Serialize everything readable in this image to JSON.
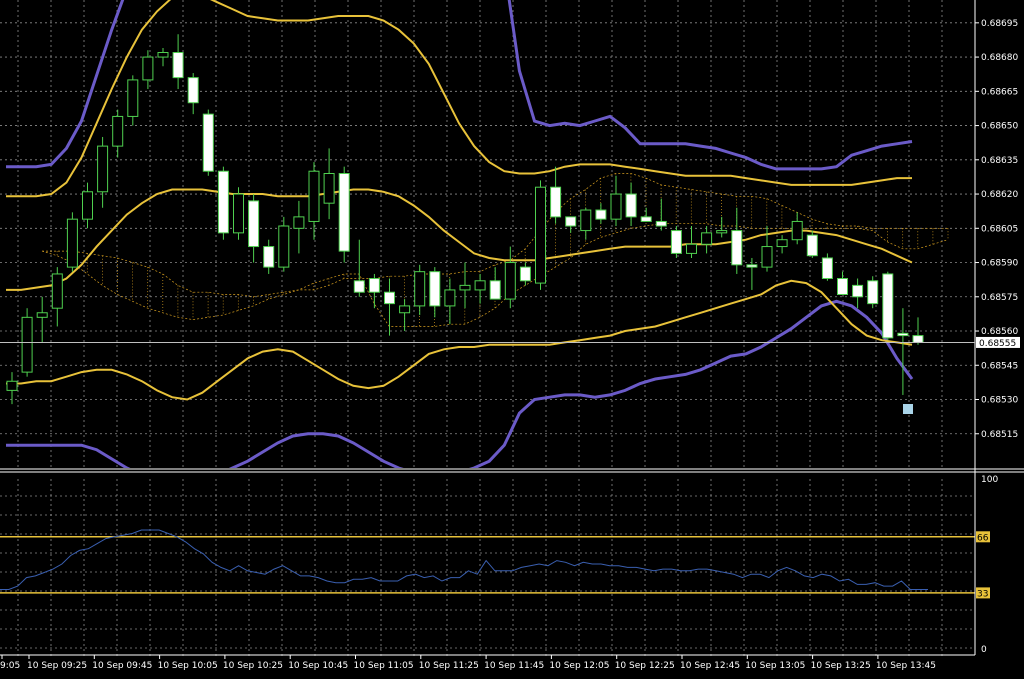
{
  "chart_data": {
    "type": "candlestick",
    "colors": {
      "background": "#000000",
      "grid": "#8c8c8c",
      "candle_up": "#ffffff",
      "candle_down": "#ffffff",
      "wick": "#4fd04f",
      "bb_outer": "#6b5bc8",
      "bb_inner": "#e8c23a",
      "cloud": "#d8a020",
      "oscillator": "#3a5fb0",
      "level": "#e8c23a",
      "axis_text": "#ffffff"
    },
    "price_axis": {
      "ylim": [
        0.685,
        0.68705
      ],
      "ticks": [
        "0.68695",
        "0.68680",
        "0.68665",
        "0.68650",
        "0.68635",
        "0.68620",
        "0.68605",
        "0.68590",
        "0.68575",
        "0.68560",
        "0.68545",
        "0.68530",
        "0.68515"
      ]
    },
    "current_price": "0.68555",
    "x_labels": [
      "9:05",
      "10 Sep 09:25",
      "10 Sep 09:45",
      "10 Sep 10:05",
      "10 Sep 10:25",
      "10 Sep 10:45",
      "10 Sep 11:05",
      "10 Sep 11:25",
      "10 Sep 11:45",
      "10 Sep 12:05",
      "10 Sep 12:25",
      "10 Sep 12:45",
      "10 Sep 13:05",
      "10 Sep 13:25",
      "10 Sep 13:45"
    ],
    "candles": [
      {
        "o": 0.68534,
        "h": 0.68542,
        "l": 0.68528,
        "c": 0.68538
      },
      {
        "o": 0.68542,
        "h": 0.6857,
        "l": 0.6854,
        "c": 0.68566
      },
      {
        "o": 0.68566,
        "h": 0.68575,
        "l": 0.68555,
        "c": 0.68568
      },
      {
        "o": 0.6857,
        "h": 0.68588,
        "l": 0.68562,
        "c": 0.68585
      },
      {
        "o": 0.68588,
        "h": 0.68612,
        "l": 0.68586,
        "c": 0.68609
      },
      {
        "o": 0.68609,
        "h": 0.68625,
        "l": 0.68605,
        "c": 0.68621
      },
      {
        "o": 0.68621,
        "h": 0.68645,
        "l": 0.68614,
        "c": 0.68641
      },
      {
        "o": 0.68641,
        "h": 0.68657,
        "l": 0.68636,
        "c": 0.68654
      },
      {
        "o": 0.68654,
        "h": 0.68672,
        "l": 0.6865,
        "c": 0.6867
      },
      {
        "o": 0.6867,
        "h": 0.68683,
        "l": 0.68666,
        "c": 0.6868
      },
      {
        "o": 0.6868,
        "h": 0.68684,
        "l": 0.68676,
        "c": 0.68682
      },
      {
        "o": 0.68682,
        "h": 0.6869,
        "l": 0.68666,
        "c": 0.68671
      },
      {
        "o": 0.68671,
        "h": 0.68673,
        "l": 0.68655,
        "c": 0.6866
      },
      {
        "o": 0.68655,
        "h": 0.68657,
        "l": 0.68628,
        "c": 0.6863
      },
      {
        "o": 0.6863,
        "h": 0.68632,
        "l": 0.686,
        "c": 0.68603
      },
      {
        "o": 0.68603,
        "h": 0.68623,
        "l": 0.686,
        "c": 0.6862
      },
      {
        "o": 0.68617,
        "h": 0.6862,
        "l": 0.6859,
        "c": 0.68597
      },
      {
        "o": 0.68597,
        "h": 0.686,
        "l": 0.68585,
        "c": 0.68588
      },
      {
        "o": 0.68588,
        "h": 0.6861,
        "l": 0.68586,
        "c": 0.68606
      },
      {
        "o": 0.68605,
        "h": 0.68617,
        "l": 0.68594,
        "c": 0.6861
      },
      {
        "o": 0.68608,
        "h": 0.68634,
        "l": 0.686,
        "c": 0.6863
      },
      {
        "o": 0.68616,
        "h": 0.6864,
        "l": 0.68609,
        "c": 0.68629
      },
      {
        "o": 0.68629,
        "h": 0.68632,
        "l": 0.6859,
        "c": 0.68595
      },
      {
        "o": 0.68582,
        "h": 0.686,
        "l": 0.68575,
        "c": 0.68577
      },
      {
        "o": 0.68583,
        "h": 0.68585,
        "l": 0.6857,
        "c": 0.68577
      },
      {
        "o": 0.68577,
        "h": 0.68583,
        "l": 0.68558,
        "c": 0.68572
      },
      {
        "o": 0.68568,
        "h": 0.68574,
        "l": 0.6856,
        "c": 0.68571
      },
      {
        "o": 0.68571,
        "h": 0.68589,
        "l": 0.68567,
        "c": 0.68586
      },
      {
        "o": 0.68586,
        "h": 0.68588,
        "l": 0.68566,
        "c": 0.68571
      },
      {
        "o": 0.68571,
        "h": 0.68583,
        "l": 0.68563,
        "c": 0.68578
      },
      {
        "o": 0.68578,
        "h": 0.6859,
        "l": 0.6857,
        "c": 0.6858
      },
      {
        "o": 0.68578,
        "h": 0.68585,
        "l": 0.68572,
        "c": 0.68582
      },
      {
        "o": 0.68582,
        "h": 0.68588,
        "l": 0.68574,
        "c": 0.68574
      },
      {
        "o": 0.68574,
        "h": 0.68597,
        "l": 0.6857,
        "c": 0.6859
      },
      {
        "o": 0.68588,
        "h": 0.6859,
        "l": 0.6858,
        "c": 0.68582
      },
      {
        "o": 0.68581,
        "h": 0.68626,
        "l": 0.68578,
        "c": 0.68623
      },
      {
        "o": 0.68623,
        "h": 0.68632,
        "l": 0.68607,
        "c": 0.6861
      },
      {
        "o": 0.6861,
        "h": 0.68606,
        "l": 0.68603,
        "c": 0.68606
      },
      {
        "o": 0.68604,
        "h": 0.68614,
        "l": 0.686,
        "c": 0.68613
      },
      {
        "o": 0.68613,
        "h": 0.68616,
        "l": 0.68607,
        "c": 0.68609
      },
      {
        "o": 0.68609,
        "h": 0.68628,
        "l": 0.68606,
        "c": 0.6862
      },
      {
        "o": 0.6862,
        "h": 0.68625,
        "l": 0.68606,
        "c": 0.6861
      },
      {
        "o": 0.6861,
        "h": 0.68614,
        "l": 0.68608,
        "c": 0.68608
      },
      {
        "o": 0.68608,
        "h": 0.68618,
        "l": 0.68604,
        "c": 0.68606
      },
      {
        "o": 0.68604,
        "h": 0.68606,
        "l": 0.68592,
        "c": 0.68594
      },
      {
        "o": 0.68594,
        "h": 0.68606,
        "l": 0.68592,
        "c": 0.68598
      },
      {
        "o": 0.68598,
        "h": 0.68606,
        "l": 0.68594,
        "c": 0.68603
      },
      {
        "o": 0.68603,
        "h": 0.6861,
        "l": 0.68601,
        "c": 0.68604
      },
      {
        "o": 0.68604,
        "h": 0.68614,
        "l": 0.68585,
        "c": 0.68589
      },
      {
        "o": 0.68589,
        "h": 0.68592,
        "l": 0.68578,
        "c": 0.68588
      },
      {
        "o": 0.68588,
        "h": 0.68606,
        "l": 0.68586,
        "c": 0.68597
      },
      {
        "o": 0.68597,
        "h": 0.68602,
        "l": 0.68594,
        "c": 0.686
      },
      {
        "o": 0.686,
        "h": 0.68612,
        "l": 0.68598,
        "c": 0.68608
      },
      {
        "o": 0.68602,
        "h": 0.68604,
        "l": 0.68592,
        "c": 0.68593
      },
      {
        "o": 0.68592,
        "h": 0.68594,
        "l": 0.68582,
        "c": 0.68583
      },
      {
        "o": 0.68583,
        "h": 0.68586,
        "l": 0.68576,
        "c": 0.68576
      },
      {
        "o": 0.6858,
        "h": 0.68583,
        "l": 0.6857,
        "c": 0.68575
      },
      {
        "o": 0.68582,
        "h": 0.68584,
        "l": 0.6857,
        "c": 0.68572
      },
      {
        "o": 0.68585,
        "h": 0.68586,
        "l": 0.68556,
        "c": 0.68557
      },
      {
        "o": 0.68559,
        "h": 0.6857,
        "l": 0.68532,
        "c": 0.68558
      },
      {
        "o": 0.68558,
        "h": 0.68566,
        "l": 0.68554,
        "c": 0.68555
      }
    ],
    "bb_outer_upper": [
      0.68632,
      0.68632,
      0.68632,
      0.68633,
      0.6864,
      0.68652,
      0.68672,
      0.68692,
      0.6871,
      0.68725,
      0.68735,
      0.6874,
      0.68742,
      0.68742,
      0.68742,
      0.68742,
      0.68742,
      0.68742,
      0.68742,
      0.68742,
      0.68742,
      0.68742,
      0.68742,
      0.68742,
      0.68742,
      0.68742,
      0.68742,
      0.68742,
      0.68742,
      0.68742,
      0.68742,
      0.68742,
      0.68742,
      0.6872,
      0.68674,
      0.68652,
      0.6865,
      0.68651,
      0.6865,
      0.68652,
      0.68654,
      0.68649,
      0.68642,
      0.68642,
      0.68642,
      0.68642,
      0.68641,
      0.6864,
      0.68638,
      0.68636,
      0.68633,
      0.68631,
      0.68631,
      0.68631,
      0.68631,
      0.68632,
      0.68637,
      0.68639,
      0.68641,
      0.68642,
      0.68643
    ],
    "bb_inner_upper": [
      0.68619,
      0.68619,
      0.68619,
      0.6862,
      0.68625,
      0.68636,
      0.68651,
      0.68666,
      0.6868,
      0.68692,
      0.687,
      0.68706,
      0.68708,
      0.68707,
      0.68704,
      0.68701,
      0.68698,
      0.68697,
      0.68696,
      0.68696,
      0.68696,
      0.68697,
      0.68698,
      0.68698,
      0.68698,
      0.68696,
      0.68692,
      0.68686,
      0.68677,
      0.68664,
      0.68651,
      0.68641,
      0.68634,
      0.6863,
      0.68629,
      0.68629,
      0.6863,
      0.68632,
      0.68633,
      0.68633,
      0.68633,
      0.68632,
      0.68631,
      0.6863,
      0.68629,
      0.68628,
      0.68628,
      0.68628,
      0.68628,
      0.68627,
      0.68626,
      0.68625,
      0.68624,
      0.68624,
      0.68624,
      0.68624,
      0.68624,
      0.68625,
      0.68626,
      0.68627,
      0.68627
    ],
    "bb_middle": [
      0.68578,
      0.68578,
      0.68579,
      0.6858,
      0.68583,
      0.68589,
      0.68597,
      0.68604,
      0.68611,
      0.68616,
      0.6862,
      0.68622,
      0.68622,
      0.68622,
      0.68621,
      0.6862,
      0.6862,
      0.6862,
      0.68619,
      0.68619,
      0.68619,
      0.6862,
      0.68621,
      0.68622,
      0.68622,
      0.68621,
      0.68619,
      0.68615,
      0.6861,
      0.68604,
      0.68599,
      0.68594,
      0.68592,
      0.68591,
      0.68591,
      0.68591,
      0.68592,
      0.68593,
      0.68594,
      0.68595,
      0.68596,
      0.68597,
      0.68597,
      0.68597,
      0.68597,
      0.68598,
      0.68598,
      0.68598,
      0.68599,
      0.686,
      0.68602,
      0.68603,
      0.68604,
      0.68604,
      0.68603,
      0.68602,
      0.686,
      0.68598,
      0.68596,
      0.68593,
      0.6859
    ],
    "bb_inner_lower": [
      0.68537,
      0.68537,
      0.68538,
      0.68538,
      0.6854,
      0.68542,
      0.68543,
      0.68543,
      0.68541,
      0.68538,
      0.68534,
      0.68531,
      0.6853,
      0.68533,
      0.68538,
      0.68543,
      0.68548,
      0.68551,
      0.68552,
      0.68551,
      0.68547,
      0.68543,
      0.68539,
      0.68536,
      0.68535,
      0.68536,
      0.6854,
      0.68545,
      0.6855,
      0.68552,
      0.68553,
      0.68553,
      0.68554,
      0.68554,
      0.68554,
      0.68554,
      0.68554,
      0.68555,
      0.68556,
      0.68557,
      0.68558,
      0.6856,
      0.68561,
      0.68562,
      0.68564,
      0.68566,
      0.68568,
      0.6857,
      0.68572,
      0.68574,
      0.68576,
      0.6858,
      0.68582,
      0.68581,
      0.68577,
      0.6857,
      0.68563,
      0.68558,
      0.68556,
      0.68555,
      0.68554
    ],
    "bb_outer_lower": [
      0.6851,
      0.6851,
      0.6851,
      0.6851,
      0.6851,
      0.6851,
      0.68508,
      0.68504,
      0.685,
      0.68497,
      0.68495,
      0.68494,
      0.68494,
      0.68495,
      0.68497,
      0.685,
      0.68503,
      0.68507,
      0.68511,
      0.68514,
      0.68515,
      0.68515,
      0.68514,
      0.68511,
      0.68507,
      0.68503,
      0.685,
      0.68498,
      0.68497,
      0.68497,
      0.68498,
      0.685,
      0.68503,
      0.6851,
      0.68524,
      0.6853,
      0.68531,
      0.68532,
      0.68532,
      0.68531,
      0.68532,
      0.68534,
      0.68537,
      0.68539,
      0.6854,
      0.68541,
      0.68543,
      0.68546,
      0.68549,
      0.6855,
      0.68553,
      0.68557,
      0.68561,
      0.68566,
      0.68571,
      0.68573,
      0.68571,
      0.68566,
      0.68559,
      0.68548,
      0.68539
    ],
    "cloud_a": [
      0.68595,
      0.68595,
      0.68595,
      0.68594,
      0.68593,
      0.68592,
      0.6859,
      0.68588,
      0.68585,
      0.6858,
      0.68577,
      0.68577,
      0.68576,
      0.68576,
      0.68575,
      0.68576,
      0.68577,
      0.68578,
      0.68578,
      0.6858,
      0.68583,
      0.68583,
      0.68583,
      0.68584,
      0.68584,
      0.68585,
      0.68585,
      0.68585,
      0.68586,
      0.68586,
      0.68589,
      0.68591,
      0.68596,
      0.68604,
      0.68612,
      0.68618,
      0.68622,
      0.68627,
      0.68629,
      0.68629,
      0.68627,
      0.68624,
      0.68623,
      0.68622,
      0.68621,
      0.6862,
      0.68619,
      0.68619,
      0.68618,
      0.68615,
      0.68612,
      0.68609,
      0.68607,
      0.68606,
      0.68606,
      0.68605,
      0.68605,
      0.68605,
      0.68605,
      0.68605,
      0.68605
    ],
    "cloud_b": [
      0.68595,
      0.68593,
      0.6859,
      0.68585,
      0.6858,
      0.68576,
      0.68573,
      0.6857,
      0.68568,
      0.68566,
      0.68565,
      0.68566,
      0.68567,
      0.68569,
      0.68571,
      0.68574,
      0.68576,
      0.68578,
      0.68581,
      0.68583,
      0.68585,
      0.68585,
      0.68572,
      0.68562,
      0.68562,
      0.68562,
      0.68562,
      0.68563,
      0.68563,
      0.68566,
      0.6857,
      0.68576,
      0.6858,
      0.68584,
      0.68588,
      0.68592,
      0.68598,
      0.68601,
      0.68603,
      0.68605,
      0.68606,
      0.68607,
      0.68607,
      0.68607,
      0.68607,
      0.68606,
      0.68606,
      0.68605,
      0.68605,
      0.68605,
      0.68605,
      0.68605,
      0.68605,
      0.68605,
      0.68605,
      0.68604,
      0.68599,
      0.68596,
      0.68596,
      0.68598,
      0.686
    ],
    "oscillator": {
      "ylim": [
        0,
        100
      ],
      "ticks": [
        "100",
        "0"
      ],
      "levels": [
        "66",
        "33"
      ],
      "level_values": [
        66,
        33
      ],
      "values": [
        35,
        35,
        37,
        42,
        43,
        45,
        47,
        50,
        55,
        58,
        59,
        62,
        65,
        66,
        67,
        68,
        70,
        70,
        70,
        68,
        66,
        63,
        59,
        56,
        51,
        48,
        46,
        49,
        46,
        45,
        44,
        47,
        49,
        46,
        43,
        43,
        42,
        40,
        39,
        39,
        41,
        41,
        42,
        40,
        40,
        40,
        43,
        44,
        42,
        43,
        40,
        42,
        42,
        46,
        44,
        52,
        46,
        46,
        46,
        48,
        49,
        50,
        49,
        52,
        51,
        49,
        51,
        50,
        50,
        49,
        49,
        48,
        48,
        47,
        46,
        47,
        47,
        46,
        46,
        47,
        47,
        46,
        45,
        44,
        42,
        44,
        44,
        42,
        46,
        48,
        46,
        43,
        42,
        44,
        43,
        40,
        41,
        38,
        38,
        39,
        37,
        37,
        40,
        35,
        35,
        35
      ]
    }
  }
}
